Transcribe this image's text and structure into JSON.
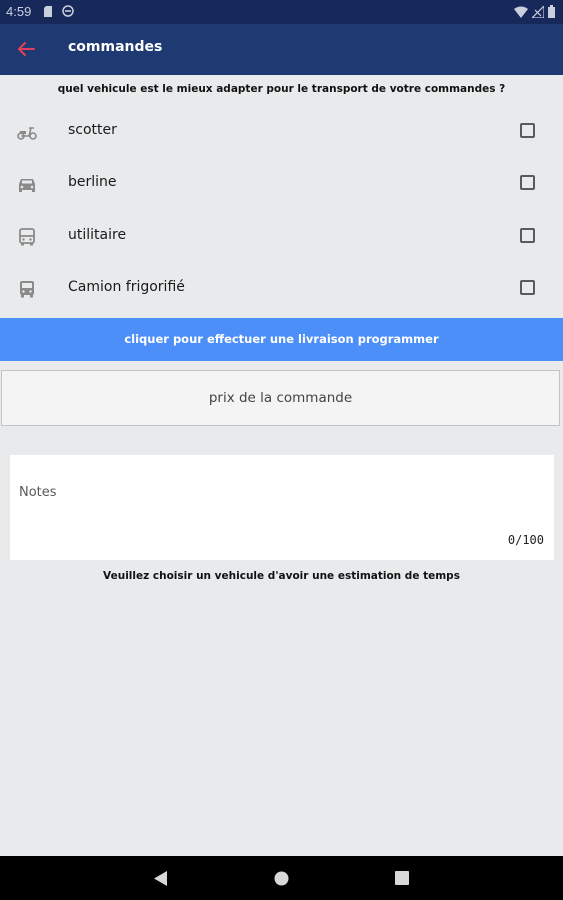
{
  "status_bar": {
    "time": "4:59"
  },
  "app_bar": {
    "title": "commandes"
  },
  "question": "quel vehicule est le mieux adapter pour le transport de votre commandes ?",
  "vehicles": [
    {
      "label": "scotter",
      "icon": "scooter-icon",
      "checked": false
    },
    {
      "label": "berline",
      "icon": "car-icon",
      "checked": false
    },
    {
      "label": "utilitaire",
      "icon": "van-icon",
      "checked": false
    },
    {
      "label": "Camion frigorifié",
      "icon": "truck-icon",
      "checked": false
    }
  ],
  "schedule_button": "cliquer pour effectuer une livraison programmer",
  "price_button": "prix de la commande",
  "notes": {
    "placeholder": "Notes",
    "counter": "0/100"
  },
  "estimate_text": "Veuillez choisir un vehicule d'avoir une estimation de temps",
  "colors": {
    "status_bar": "#16295a",
    "app_bar": "#1f3a72",
    "accent_back": "#e0405a",
    "primary_button": "#4d8ff8",
    "background": "#e8eaec"
  }
}
